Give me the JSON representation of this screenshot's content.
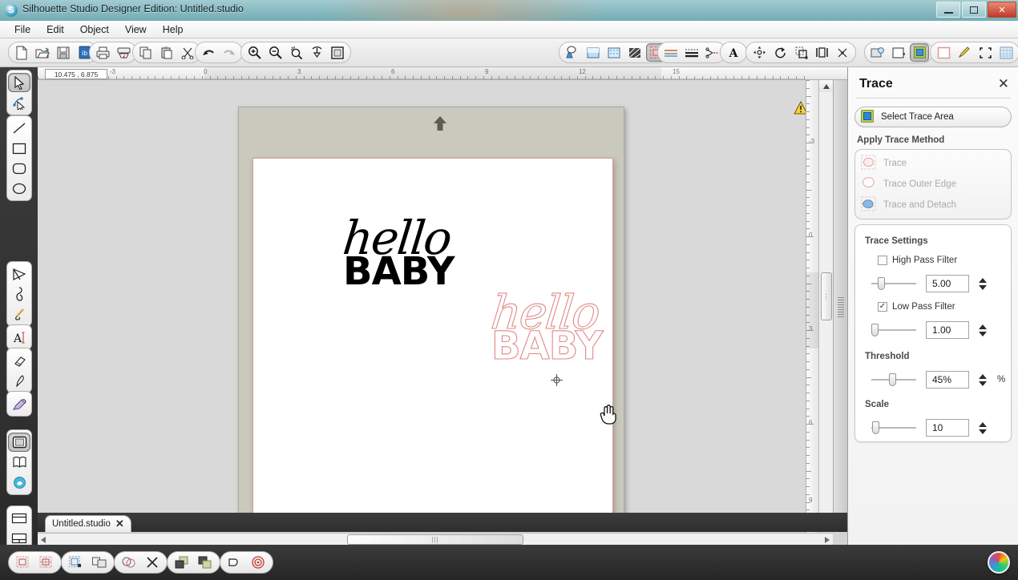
{
  "window": {
    "title": "Silhouette Studio Designer Edition: Untitled.studio",
    "app_icon": "silhouette-logo-icon",
    "minimize": "–",
    "maximize": "□",
    "close": "✕"
  },
  "menubar": {
    "items": [
      {
        "label": "File"
      },
      {
        "label": "Edit"
      },
      {
        "label": "Object"
      },
      {
        "label": "View"
      },
      {
        "label": "Help"
      }
    ]
  },
  "toolbar": {
    "groups": [
      {
        "name": "file-group",
        "buttons": [
          {
            "name": "new-document-icon"
          },
          {
            "name": "open-document-icon"
          },
          {
            "name": "save-document-icon"
          },
          {
            "name": "library-icon"
          }
        ]
      },
      {
        "name": "print-group",
        "buttons": [
          {
            "name": "print-icon"
          },
          {
            "name": "send-to-silhouette-icon"
          }
        ]
      },
      {
        "name": "clipboard-group",
        "buttons": [
          {
            "name": "copy-icon"
          },
          {
            "name": "paste-icon"
          },
          {
            "name": "cut-scissors-icon"
          }
        ]
      },
      {
        "name": "history-group",
        "buttons": [
          {
            "name": "undo-icon"
          },
          {
            "name": "redo-icon"
          }
        ]
      },
      {
        "name": "zoom-group",
        "buttons": [
          {
            "name": "zoom-in-icon"
          },
          {
            "name": "zoom-out-icon"
          },
          {
            "name": "zoom-selection-icon"
          },
          {
            "name": "zoom-pan-icon"
          },
          {
            "name": "fit-to-page-icon"
          }
        ]
      },
      {
        "name": "fill-group",
        "buttons": [
          {
            "name": "line-color-icon"
          },
          {
            "name": "fill-color-icon"
          },
          {
            "name": "gradient-fill-icon"
          },
          {
            "name": "pattern-fill-icon"
          },
          {
            "name": "trace-panel-icon"
          }
        ]
      },
      {
        "name": "line-group",
        "buttons": [
          {
            "name": "line-style-icon"
          },
          {
            "name": "line-thickness-icon"
          },
          {
            "name": "cut-style-icon"
          }
        ]
      },
      {
        "name": "text-group",
        "buttons": [
          {
            "name": "text-style-icon"
          }
        ]
      },
      {
        "name": "transform-group",
        "buttons": [
          {
            "name": "move-transform-icon"
          },
          {
            "name": "rotate-icon"
          },
          {
            "name": "scale-icon"
          },
          {
            "name": "align-icon"
          },
          {
            "name": "replicate-icon"
          }
        ]
      },
      {
        "name": "page-group",
        "buttons": [
          {
            "name": "page-setup-icon"
          },
          {
            "name": "registration-marks-icon"
          },
          {
            "name": "select-trace-area-icon"
          }
        ]
      },
      {
        "name": "view-group",
        "buttons": [
          {
            "name": "show-cut-border-icon"
          },
          {
            "name": "sketch-pen-icon"
          },
          {
            "name": "crop-view-icon"
          },
          {
            "name": "grid-icon"
          }
        ]
      }
    ]
  },
  "lefttool": {
    "groups": [
      {
        "name": "select-group",
        "buttons": [
          {
            "name": "select-arrow-tool",
            "active": true
          },
          {
            "name": "edit-points-tool"
          }
        ]
      },
      {
        "name": "shape-group",
        "buttons": [
          {
            "name": "line-tool"
          },
          {
            "name": "rectangle-tool"
          },
          {
            "name": "rounded-rectangle-tool"
          },
          {
            "name": "ellipse-tool"
          }
        ]
      },
      {
        "name": "draw-group",
        "buttons": [
          {
            "name": "polygon-tool"
          },
          {
            "name": "curve-tool"
          },
          {
            "name": "freehand-tool"
          }
        ]
      },
      {
        "name": "text-group",
        "buttons": [
          {
            "name": "text-tool"
          }
        ]
      },
      {
        "name": "erase-group",
        "buttons": [
          {
            "name": "eraser-tool"
          },
          {
            "name": "knife-tool"
          }
        ]
      },
      {
        "name": "sketch-group",
        "buttons": [
          {
            "name": "sketch-tool"
          }
        ]
      },
      {
        "name": "library-group",
        "buttons": [
          {
            "name": "design-page-tool",
            "active": true
          },
          {
            "name": "my-library-tool"
          },
          {
            "name": "silhouette-store-tool"
          }
        ]
      },
      {
        "name": "layout-group",
        "buttons": [
          {
            "name": "page-layout-tool"
          },
          {
            "name": "cut-settings-tool"
          }
        ]
      }
    ]
  },
  "workspace": {
    "coordinates": "10.475 , 6.875",
    "h_ruler_labels": [
      "-3",
      "0",
      "3",
      "6",
      "9",
      "12",
      "15"
    ],
    "v_ruler_labels": [
      "-3",
      "0",
      "3",
      "6",
      "9"
    ],
    "mat_arrow_icon": "mat-load-arrow-icon",
    "warning_icon": "warning-triangle-icon",
    "artwork": {
      "original": {
        "name": "hello-baby-black-artwork",
        "script_text": "hello",
        "block_text": "BABY"
      },
      "traced": {
        "name": "hello-baby-traced-outline",
        "script_text": "hello",
        "block_text": "BABY",
        "color": "#df8a86"
      }
    },
    "cursors": {
      "crosshair": "crosshair-cursor-icon",
      "hand": "hand-cursor-icon"
    }
  },
  "tabs": {
    "documents": [
      {
        "label": "Untitled.studio",
        "close": "✕"
      }
    ]
  },
  "bottombar": {
    "groups": [
      {
        "name": "weld-group",
        "buttons": [
          {
            "name": "weld-icon"
          },
          {
            "name": "unweld-icon"
          }
        ]
      },
      {
        "name": "group-group",
        "buttons": [
          {
            "name": "group-icon"
          },
          {
            "name": "ungroup-icon"
          }
        ]
      },
      {
        "name": "modify-group",
        "buttons": [
          {
            "name": "modify-icon"
          },
          {
            "name": "subtract-icon"
          }
        ]
      },
      {
        "name": "arrange-group",
        "buttons": [
          {
            "name": "bring-to-front-icon"
          },
          {
            "name": "send-to-back-icon"
          }
        ]
      },
      {
        "name": "offset-group",
        "buttons": [
          {
            "name": "offset-icon"
          },
          {
            "name": "registration-target-icon"
          }
        ]
      }
    ],
    "color_wheel": "color-wheel-icon"
  },
  "trace_panel": {
    "title": "Trace",
    "close": "✕",
    "select_trace_area": {
      "label": "Select Trace Area",
      "icon": "select-trace-area-icon"
    },
    "apply_trace_method_label": "Apply Trace Method",
    "methods": [
      {
        "label": "Trace",
        "icon": "trace-icon",
        "disabled": true
      },
      {
        "label": "Trace Outer Edge",
        "icon": "trace-outer-edge-icon",
        "disabled": true
      },
      {
        "label": "Trace and Detach",
        "icon": "trace-and-detach-icon",
        "disabled": true
      }
    ],
    "settings_label": "Trace Settings",
    "high_pass_filter": {
      "label": "High Pass Filter",
      "checked": false,
      "value": "5.00",
      "slider_pct": 18
    },
    "low_pass_filter": {
      "label": "Low Pass Filter",
      "checked": true,
      "check_glyph": "✓",
      "value": "1.00",
      "slider_pct": 3
    },
    "threshold": {
      "label": "Threshold",
      "value": "45%",
      "unit": "%",
      "slider_pct": 45
    },
    "scale": {
      "label": "Scale",
      "value": "10",
      "slider_pct": 5
    }
  }
}
